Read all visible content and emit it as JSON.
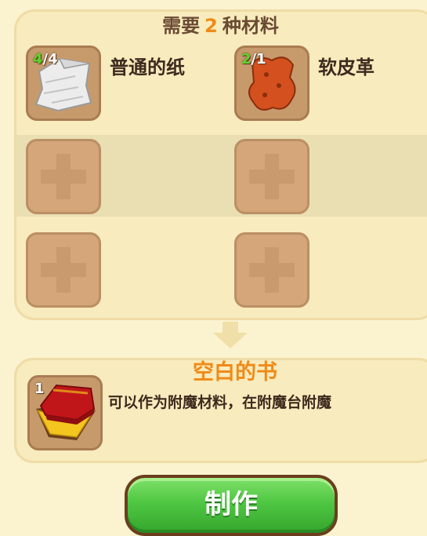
{
  "header": {
    "prefix": "需要",
    "count": "2",
    "suffix": "种材料"
  },
  "materials": [
    {
      "name": "普通的纸",
      "have": "4",
      "need": "/4",
      "icon": "paper-icon"
    },
    {
      "name": "软皮革",
      "have": "2",
      "need": "/1",
      "icon": "leather-icon"
    }
  ],
  "empty_slot_icon": "plus-icon",
  "result": {
    "count": "1",
    "name": "空白的书",
    "description": "可以作为附魔材料，在附魔台附魔",
    "icon": "book-icon"
  },
  "make_button": {
    "label": "制作"
  },
  "colors": {
    "accent_orange": "#f08a17",
    "have_green": "#5fd32a",
    "button_green": "#4fc742",
    "panel_bg": "#f8ebbd"
  }
}
